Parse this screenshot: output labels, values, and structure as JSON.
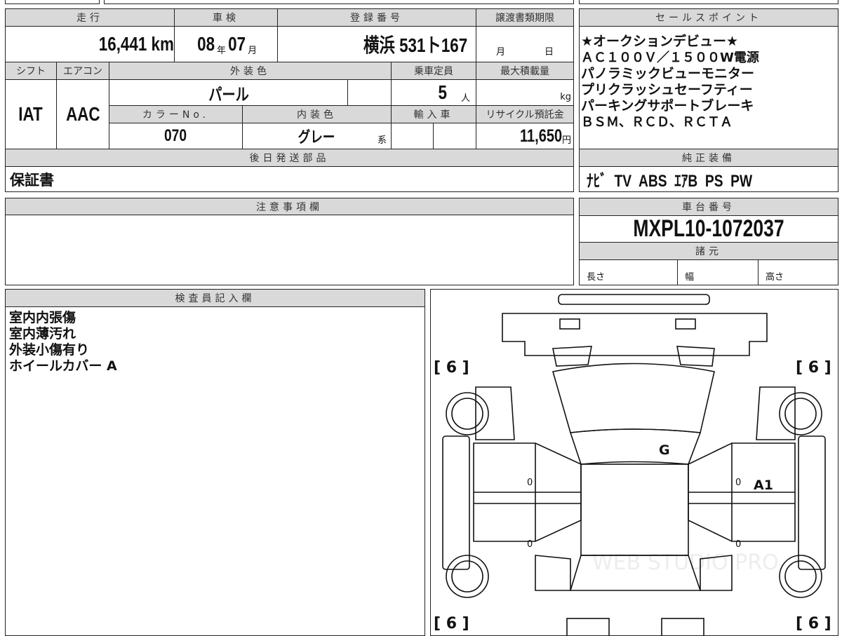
{
  "main": {
    "headers": {
      "mileage": "走行",
      "inspection": "車検",
      "registration": "登録番号",
      "transfer_deadline": "譲渡書類期限",
      "shift": "シフト",
      "aircon": "エアコン",
      "exterior_color": "外装色",
      "capacity": "乗車定員",
      "max_load": "最大積載量",
      "color_no": "カラーNo.",
      "interior_color": "内装色",
      "imported": "輸入車",
      "recycle_fee": "リサイクル預託金",
      "later_parts": "後日発送部品"
    },
    "mileage": "16,441",
    "mileage_unit": "km",
    "inspection_year": "08",
    "year_unit": "年",
    "inspection_month": "07",
    "month_unit": "月",
    "registration": "横浜 531ト167",
    "transfer_month_unit": "月",
    "transfer_day_unit": "日",
    "shift": "IAT",
    "aircon": "AAC",
    "exterior_color": "パール",
    "capacity": "5",
    "capacity_unit": "人",
    "load_unit": "kg",
    "color_no": "070",
    "interior_color": "グレー",
    "interior_suffix": "系",
    "recycle_fee": "11,650",
    "yen": "円",
    "later_parts": "保証書"
  },
  "sales": {
    "header": "セールスポイント",
    "lines": [
      "★オークションデビュー★",
      "ＡＣ１００Ｖ／１５００W電源",
      "パノラミックビューモニター",
      "プリクラッシュセーフティー",
      "パーキングサポートブレーキ",
      "ＢＳＭ、ＲＣＤ、ＲＣＴＡ"
    ]
  },
  "equipment": {
    "header": "純正装備",
    "value": "ﾅﾋﾞ  TV  ABS  ｴｱB  PS  PW"
  },
  "notes": {
    "header": "注意事項欄"
  },
  "chassis": {
    "header": "車台番号",
    "value": "MXPL10-1072037",
    "spec_header": "諸元",
    "length": "長さ",
    "width": "幅",
    "height": "高さ"
  },
  "inspector": {
    "header": "検査員記入欄",
    "lines": [
      "室内内張傷",
      "室内薄汚れ",
      "外装小傷有り",
      "ホイールカバー A"
    ]
  },
  "diagram": {
    "tire_marks": [
      "[ 6 ]",
      "[ 6 ]",
      "[ 6 ]",
      "[ 6 ]"
    ],
    "marks": {
      "roof": "G",
      "right_door": "A1",
      "zero": "0"
    },
    "watermark": "WEB STUDIO PRO"
  }
}
